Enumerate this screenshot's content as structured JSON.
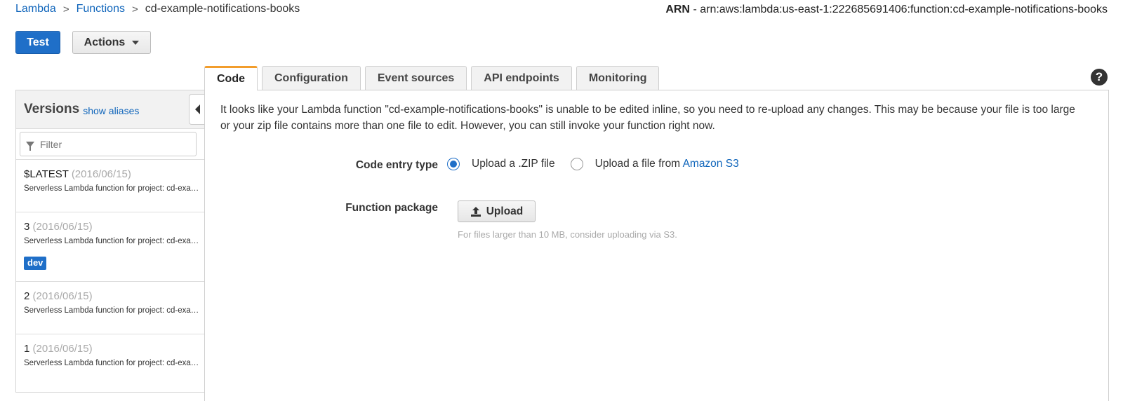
{
  "breadcrumb": {
    "items": [
      "Lambda",
      "Functions"
    ],
    "separator": ">",
    "current": "cd-example-notifications-books"
  },
  "arn": {
    "label": "ARN",
    "value": "- arn:aws:lambda:us-east-1:222685691406:function:cd-example-notifications-books"
  },
  "toolbar": {
    "test_label": "Test",
    "actions_label": "Actions"
  },
  "versions": {
    "title": "Versions",
    "show_aliases": "show aliases",
    "filter_placeholder": "Filter",
    "items": [
      {
        "name": "$LATEST",
        "date": "(2016/06/15)",
        "desc": "Serverless Lambda function for project: cd-example-notifications-books",
        "alias": ""
      },
      {
        "name": "3",
        "date": "(2016/06/15)",
        "desc": "Serverless Lambda function for project: cd-example-notifications-books",
        "alias": "dev"
      },
      {
        "name": "2",
        "date": "(2016/06/15)",
        "desc": "Serverless Lambda function for project: cd-example-notifications-books",
        "alias": ""
      },
      {
        "name": "1",
        "date": "(2016/06/15)",
        "desc": "Serverless Lambda function for project: cd-example-notifications-books",
        "alias": ""
      }
    ]
  },
  "tabs": [
    "Code",
    "Configuration",
    "Event sources",
    "API endpoints",
    "Monitoring"
  ],
  "code": {
    "notice": "It looks like your Lambda function \"cd-example-notifications-books\" is unable to be edited inline, so you need to re-upload any changes. This may be because your file is too large or your zip file contains more than one file to edit. However, you can still invoke your function right now.",
    "entry_type_label": "Code entry type",
    "option_zip": "Upload a .ZIP file",
    "option_s3_prefix": "Upload a file from ",
    "option_s3_link": "Amazon S3",
    "package_label": "Function package",
    "upload_label": "Upload",
    "hint": "For files larger than 10 MB, consider uploading via S3."
  },
  "help_label": "?",
  "colors": {
    "primary": "#1f6fc8",
    "link": "#1166bb",
    "active_tab_accent": "#f29d2c"
  }
}
